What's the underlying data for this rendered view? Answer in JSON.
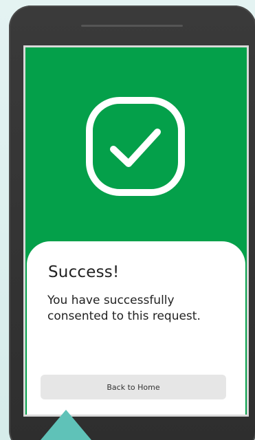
{
  "screen": {
    "title": "Success!",
    "message": "You have successfully consented to this request.",
    "button_label": "Back to Home",
    "status_icon": "checkmark-icon"
  },
  "colors": {
    "accent": "#04a04a",
    "card": "#ffffff",
    "button": "#e6e6e6",
    "pointer": "#5fc2b8",
    "device": "#333333"
  }
}
